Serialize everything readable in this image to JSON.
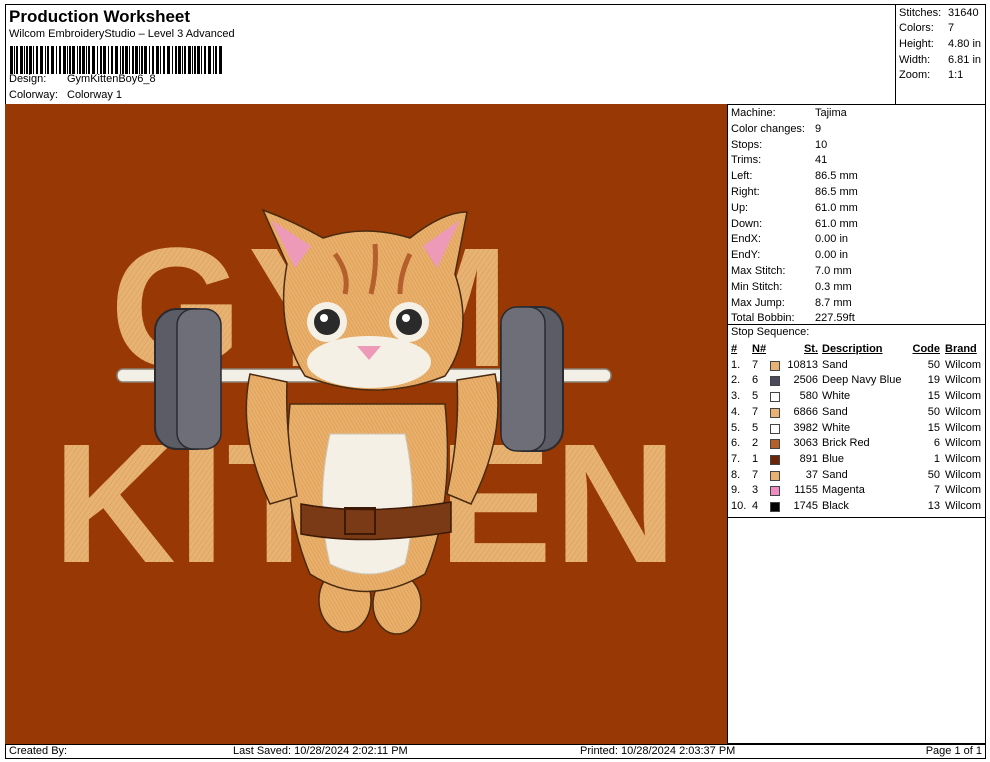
{
  "header": {
    "title": "Production Worksheet",
    "subtitle": "Wilcom EmbroideryStudio – Level 3 Advanced",
    "design_label": "Design:",
    "design_value": "GymKittenBoy6_8",
    "colorway_label": "Colorway:",
    "colorway_value": "Colorway 1"
  },
  "stats": {
    "stitches_label": "Stitches:",
    "stitches_value": "31640",
    "colors_label": "Colors:",
    "colors_value": "7",
    "height_label": "Height:",
    "height_value": "4.80 in",
    "width_label": "Width:",
    "width_value": "6.81 in",
    "zoom_label": "Zoom:",
    "zoom_value": "1:1"
  },
  "design": {
    "text_line1": "GYM",
    "text_line2": "KITTEN",
    "background": "#983804",
    "letter_color": "#e8b272"
  },
  "machine_info": [
    {
      "label": "Machine:",
      "value": "Tajima"
    },
    {
      "label": "Color changes:",
      "value": "9"
    },
    {
      "label": "Stops:",
      "value": "10"
    },
    {
      "label": "Trims:",
      "value": "41"
    },
    {
      "label": "Left:",
      "value": "86.5 mm"
    },
    {
      "label": "Right:",
      "value": "86.5 mm"
    },
    {
      "label": "Up:",
      "value": "61.0 mm"
    },
    {
      "label": "Down:",
      "value": "61.0 mm"
    },
    {
      "label": "EndX:",
      "value": "0.00 in"
    },
    {
      "label": "EndY:",
      "value": "0.00 in"
    },
    {
      "label": "Max Stitch:",
      "value": "7.0 mm"
    },
    {
      "label": "Min Stitch:",
      "value": "0.3 mm"
    },
    {
      "label": "Max Jump:",
      "value": "8.7 mm"
    },
    {
      "label": "Total Bobbin:",
      "value": "227.59ft"
    }
  ],
  "stop_sequence": {
    "title": "Stop Sequence:",
    "headers": {
      "num": "#",
      "n": "N#",
      "st": "St.",
      "desc": "Description",
      "code": "Code",
      "brand": "Brand"
    },
    "rows": [
      {
        "num": "1.",
        "n": "7",
        "color": "#e8b272",
        "st": "10813",
        "desc": "Sand",
        "code": "50",
        "brand": "Wilcom"
      },
      {
        "num": "2.",
        "n": "6",
        "color": "#4a4a5a",
        "st": "2506",
        "desc": "Deep Navy Blue",
        "code": "19",
        "brand": "Wilcom"
      },
      {
        "num": "3.",
        "n": "5",
        "color": "#ffffff",
        "st": "580",
        "desc": "White",
        "code": "15",
        "brand": "Wilcom"
      },
      {
        "num": "4.",
        "n": "7",
        "color": "#e8b272",
        "st": "6866",
        "desc": "Sand",
        "code": "50",
        "brand": "Wilcom"
      },
      {
        "num": "5.",
        "n": "5",
        "color": "#ffffff",
        "st": "3982",
        "desc": "White",
        "code": "15",
        "brand": "Wilcom"
      },
      {
        "num": "6.",
        "n": "2",
        "color": "#b5602c",
        "st": "3063",
        "desc": "Brick Red",
        "code": "6",
        "brand": "Wilcom"
      },
      {
        "num": "7.",
        "n": "1",
        "color": "#6b2508",
        "st": "891",
        "desc": "Blue",
        "code": "1",
        "brand": "Wilcom"
      },
      {
        "num": "8.",
        "n": "7",
        "color": "#e8b272",
        "st": "37",
        "desc": "Sand",
        "code": "50",
        "brand": "Wilcom"
      },
      {
        "num": "9.",
        "n": "3",
        "color": "#ee8cc0",
        "st": "1155",
        "desc": "Magenta",
        "code": "7",
        "brand": "Wilcom"
      },
      {
        "num": "10.",
        "n": "4",
        "color": "#000000",
        "st": "1745",
        "desc": "Black",
        "code": "13",
        "brand": "Wilcom"
      }
    ]
  },
  "footer": {
    "created_by": "Created By:",
    "last_saved": "Last Saved: 10/28/2024 2:02:11 PM",
    "printed": "Printed: 10/28/2024 2:03:37 PM",
    "page": "Page 1 of 1"
  }
}
